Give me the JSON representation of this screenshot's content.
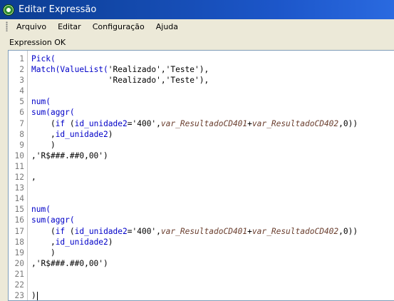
{
  "window": {
    "title": "Editar Expressão"
  },
  "menu": {
    "items": [
      "Arquivo",
      "Editar",
      "Configuração",
      "Ajuda"
    ]
  },
  "status": {
    "text": "Expression OK"
  },
  "editor": {
    "lines": [
      {
        "n": "1",
        "segments": [
          {
            "t": "Pick(",
            "c": "kw"
          }
        ]
      },
      {
        "n": "2",
        "segments": [
          {
            "t": "Match(",
            "c": "kw"
          },
          {
            "t": "ValueList(",
            "c": "kw"
          },
          {
            "t": "'Realizado','Teste'),",
            "c": ""
          }
        ]
      },
      {
        "n": "3",
        "segments": [
          {
            "t": "                'Realizado','Teste'),",
            "c": ""
          }
        ]
      },
      {
        "n": "4",
        "segments": []
      },
      {
        "n": "5",
        "segments": [
          {
            "t": "num(",
            "c": "kw"
          }
        ]
      },
      {
        "n": "6",
        "segments": [
          {
            "t": "sum(",
            "c": "kw"
          },
          {
            "t": "aggr(",
            "c": "kw"
          }
        ]
      },
      {
        "n": "7",
        "segments": [
          {
            "t": "    (",
            "c": ""
          },
          {
            "t": "if",
            "c": "kw"
          },
          {
            "t": " (",
            "c": ""
          },
          {
            "t": "id_unidade2",
            "c": "kw"
          },
          {
            "t": "='400',",
            "c": ""
          },
          {
            "t": "var_ResultadoCD401",
            "c": "var"
          },
          {
            "t": "+",
            "c": ""
          },
          {
            "t": "var_ResultadoCD402",
            "c": "var"
          },
          {
            "t": ",0))",
            "c": ""
          }
        ]
      },
      {
        "n": "8",
        "segments": [
          {
            "t": "    ,",
            "c": ""
          },
          {
            "t": "id_unidade2",
            "c": "kw"
          },
          {
            "t": ")",
            "c": ""
          }
        ]
      },
      {
        "n": "9",
        "segments": [
          {
            "t": "    )",
            "c": ""
          }
        ]
      },
      {
        "n": "10",
        "segments": [
          {
            "t": ",'R$###.##0,00')",
            "c": ""
          }
        ]
      },
      {
        "n": "11",
        "segments": []
      },
      {
        "n": "12",
        "segments": [
          {
            "t": ",",
            "c": ""
          }
        ]
      },
      {
        "n": "13",
        "segments": []
      },
      {
        "n": "14",
        "segments": []
      },
      {
        "n": "15",
        "segments": [
          {
            "t": "num(",
            "c": "kw"
          }
        ]
      },
      {
        "n": "16",
        "segments": [
          {
            "t": "sum(",
            "c": "kw"
          },
          {
            "t": "aggr(",
            "c": "kw"
          }
        ]
      },
      {
        "n": "17",
        "segments": [
          {
            "t": "    (",
            "c": ""
          },
          {
            "t": "if",
            "c": "kw"
          },
          {
            "t": " (",
            "c": ""
          },
          {
            "t": "id_unidade2",
            "c": "kw"
          },
          {
            "t": "='400',",
            "c": ""
          },
          {
            "t": "var_ResultadoCD401",
            "c": "var"
          },
          {
            "t": "+",
            "c": ""
          },
          {
            "t": "var_ResultadoCD402",
            "c": "var"
          },
          {
            "t": ",0))",
            "c": ""
          }
        ]
      },
      {
        "n": "18",
        "segments": [
          {
            "t": "    ,",
            "c": ""
          },
          {
            "t": "id_unidade2",
            "c": "kw"
          },
          {
            "t": ")",
            "c": ""
          }
        ]
      },
      {
        "n": "19",
        "segments": [
          {
            "t": "    )",
            "c": ""
          }
        ]
      },
      {
        "n": "20",
        "segments": [
          {
            "t": ",'R$###.##0,00')",
            "c": ""
          }
        ]
      },
      {
        "n": "21",
        "segments": []
      },
      {
        "n": "22",
        "segments": []
      },
      {
        "n": "23",
        "segments": [
          {
            "t": ")",
            "c": ""
          }
        ],
        "cursor": true
      }
    ]
  }
}
